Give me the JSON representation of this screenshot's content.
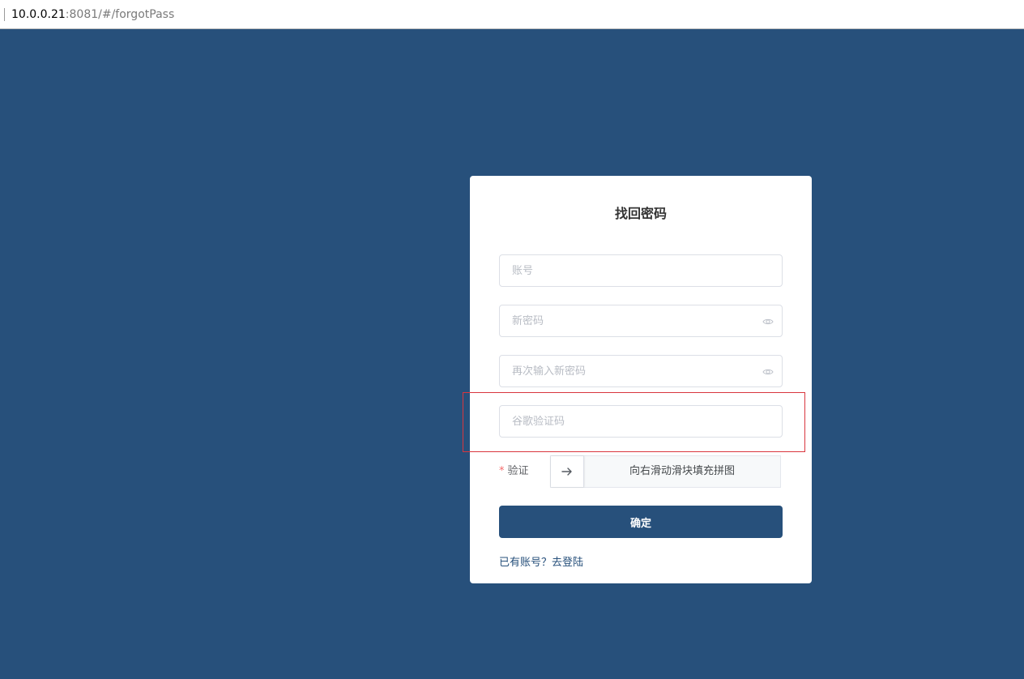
{
  "browser": {
    "url_host": "10.0.0.21",
    "url_rest": ":8081/#/forgotPass"
  },
  "form": {
    "title": "找回密码",
    "account_placeholder": "账号",
    "new_password_placeholder": "新密码",
    "confirm_password_placeholder": "再次输入新密码",
    "google_code_placeholder": "谷歌验证码",
    "verify_required_mark": "*",
    "verify_label": "验证",
    "slider_hint": "向右滑动滑块填充拼图",
    "submit_label": "确定",
    "login_link": "已有账号？去登陆"
  },
  "icons": {
    "password_toggle": "eye-icon",
    "slider_handle": "arrow-right-icon"
  },
  "colors": {
    "page_background": "#27507b",
    "primary_button": "#27507b",
    "highlight_border": "#d9363e"
  }
}
